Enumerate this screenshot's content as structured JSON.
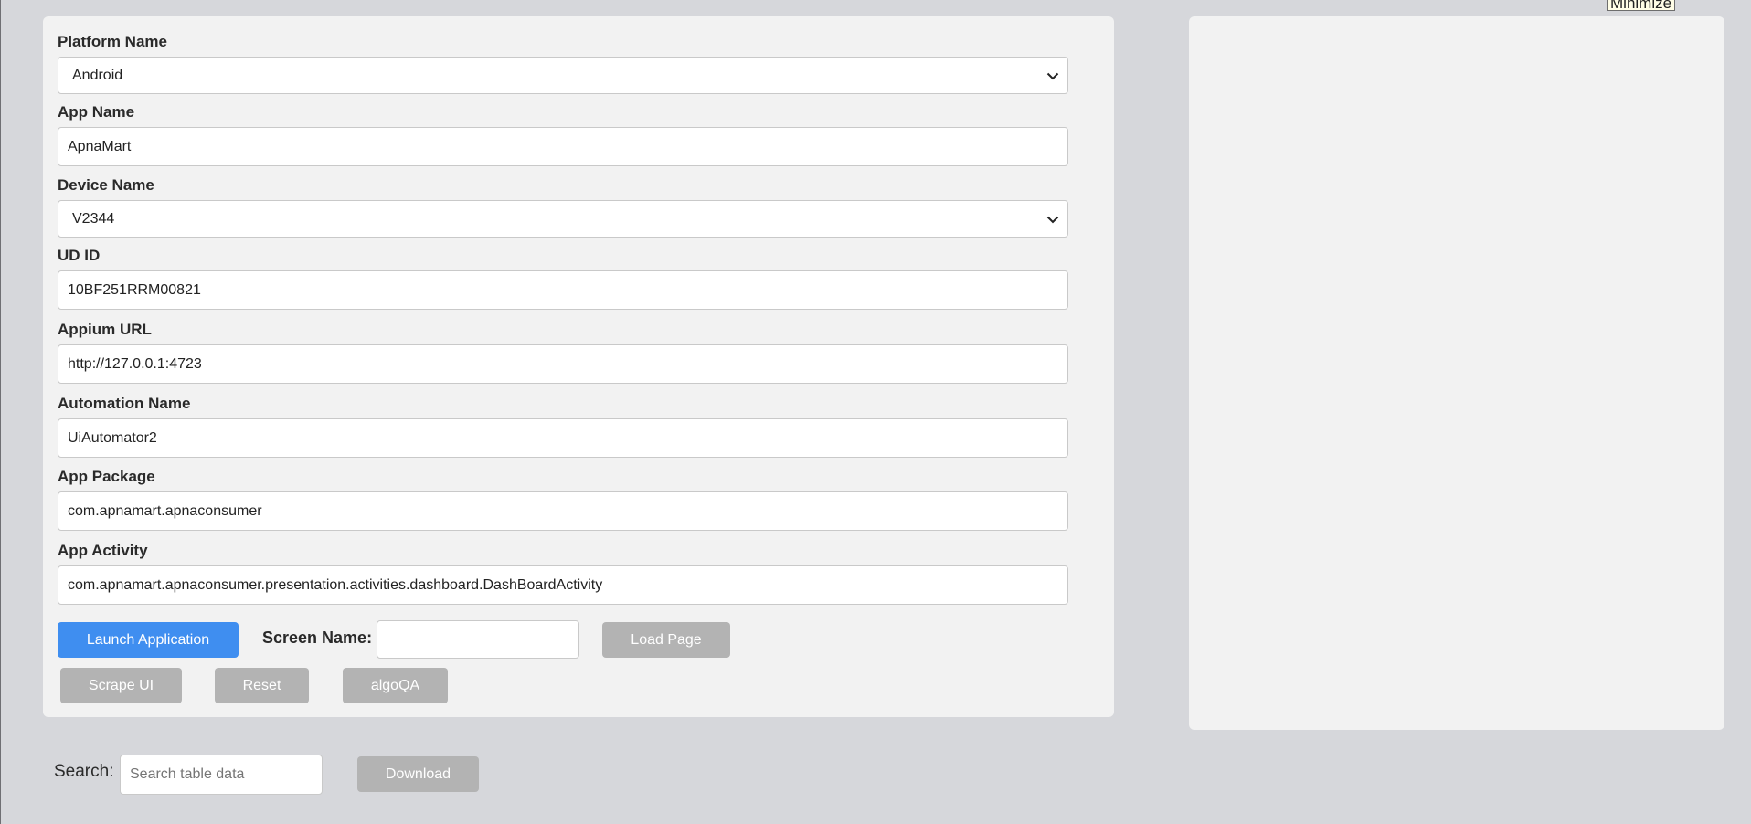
{
  "minimize_label": "Minimize",
  "form": {
    "platform": {
      "label": "Platform Name",
      "value": "Android"
    },
    "app_name": {
      "label": "App Name",
      "value": "ApnaMart"
    },
    "device": {
      "label": "Device Name",
      "value": "V2344"
    },
    "udid": {
      "label": "UD ID",
      "value": "10BF251RRM00821"
    },
    "appium_url": {
      "label": "Appium URL",
      "value": "http://127.0.0.1:4723"
    },
    "automation": {
      "label": "Automation Name",
      "value": "UiAutomator2"
    },
    "app_package": {
      "label": "App Package",
      "value": "com.apnamart.apnaconsumer"
    },
    "app_activity": {
      "label": "App Activity",
      "value": "com.apnamart.apnaconsumer.presentation.activities.dashboard.DashBoardActivity"
    }
  },
  "actions": {
    "launch_label": "Launch Application",
    "screen_name_label": "Screen Name:",
    "screen_name_value": "",
    "load_page_label": "Load Page",
    "scrape_ui_label": "Scrape UI",
    "reset_label": "Reset",
    "algoqa_label": "algoQA"
  },
  "search": {
    "label": "Search:",
    "placeholder": "Search table data",
    "download_label": "Download"
  },
  "colors": {
    "primary_button": "#3f8ef0",
    "disabled_button": "#b3b3b3",
    "panel": "#f2f2f2",
    "background": "#d6d7db"
  }
}
